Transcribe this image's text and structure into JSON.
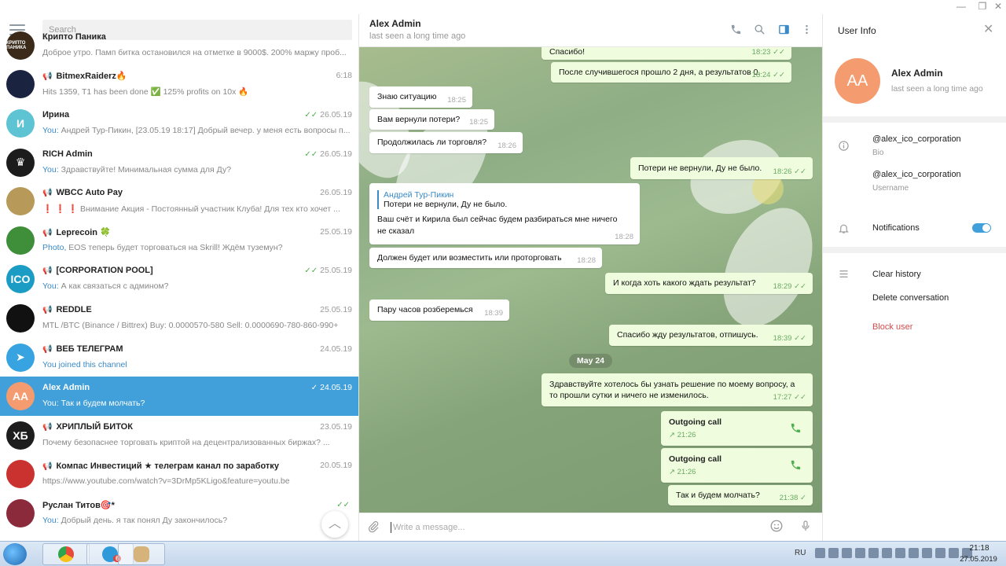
{
  "window": {
    "minimize": "—",
    "maximize": "❐",
    "close": "✕"
  },
  "search": {
    "placeholder": "Search"
  },
  "chats": [
    {
      "title": "Крипто Паника",
      "date": "",
      "preview": "Доброе утро. Памп битка остановился на отметке в 9000$. 200% маржу проб...",
      "you": "",
      "check": "",
      "avatar_text": "КРИПТО ПАНИКА",
      "avatar_color": "#3b2a1a",
      "channel": false
    },
    {
      "title": "BitmexRaiderz🔥",
      "date": "6:18",
      "preview": "Hits 1359, T1 has been done ✅  125% profits on 10x 🔥",
      "you": "",
      "check": "",
      "avatar_text": "",
      "avatar_color": "#1a2340",
      "channel": true
    },
    {
      "title": "Ирина",
      "date": "26.05.19",
      "preview": "Андрей Тур-Пикин, [23.05.19 18:17] Добрый вечер. у меня есть вопросы п...",
      "you": "You: ",
      "check": "✓✓",
      "avatar_text": "И",
      "avatar_color": "#5ec3d3",
      "channel": false
    },
    {
      "title": "RICH Admin",
      "date": "26.05.19",
      "preview": "Здравствуйте! Минимальная сумма для Ду?",
      "you": "You: ",
      "check": "✓✓",
      "avatar_text": "♛",
      "avatar_color": "#1c1c1c",
      "channel": false
    },
    {
      "title": "WBCC Auto Pay",
      "date": "26.05.19",
      "preview": "❗ ❗ ❗  Внимание Акция - Постоянный участник Клуба!   Для тех кто хочет ...",
      "you": "",
      "check": "",
      "avatar_text": "",
      "avatar_color": "#b79a5a",
      "channel": true
    },
    {
      "title": "Leprecoin 🍀",
      "date": "25.05.19",
      "preview": "EOS теперь будет торговаться на Skrill! Ждём туземун?",
      "you": "Photo, ",
      "check": "",
      "avatar_text": "",
      "avatar_color": "#3f8f3a",
      "channel": true
    },
    {
      "title": "[CORPORATION POOL]",
      "date": "25.05.19",
      "preview": "А как связаться с админом?",
      "you": "You: ",
      "check": "✓✓",
      "avatar_text": "ICO",
      "avatar_color": "#1b9cc4",
      "channel": true
    },
    {
      "title": "REDDLE",
      "date": "25.05.19",
      "preview": "MTL /BTC (Binance / Bittrex)  Buy: 0.0000570-580  Sell: 0.0000690-780-860-990+",
      "you": "",
      "check": "",
      "avatar_text": "",
      "avatar_color": "#111111",
      "channel": true
    },
    {
      "title": "ВЕБ ТЕЛЕГРАМ",
      "date": "24.05.19",
      "preview": "You joined this channel",
      "you": "",
      "check": "",
      "avatar_text": "➤",
      "avatar_color": "#37a3e0",
      "channel": true
    },
    {
      "title": "Alex Admin",
      "date": "24.05.19",
      "preview": "Так и будем молчать?",
      "you": "You: ",
      "check": "✓",
      "avatar_text": "AA",
      "avatar_color": "#f49c6f",
      "channel": false,
      "active": true
    },
    {
      "title": "ХРИПЛЫЙ БИТОК",
      "date": "23.05.19",
      "preview": "Почему безопаснее торговать криптой на децентрализованных биржах? ...",
      "you": "",
      "check": "",
      "avatar_text": "ХБ",
      "avatar_color": "#1d1d1d",
      "channel": true
    },
    {
      "title": "Компас Инвестиций ★ телеграм канал по заработку",
      "date": "20.05.19",
      "preview": "https://www.youtube.com/watch?v=3DrMp5KLigo&feature=youtu.be",
      "you": "",
      "check": "",
      "avatar_text": "",
      "avatar_color": "#c9322e",
      "channel": true
    },
    {
      "title": "Руслан Титов🎯*",
      "date": "",
      "preview": "Добрый день. я так понял Ду закончилось?",
      "you": "You: ",
      "check": "✓✓",
      "avatar_text": "",
      "avatar_color": "#8a2a3a",
      "channel": false
    }
  ],
  "header": {
    "name": "Alex Admin",
    "status": "last seen a long time ago"
  },
  "messages": {
    "m1": {
      "text": "Спасибо!",
      "time": "18:23"
    },
    "m2": {
      "text": "После случившегося прошло 2 дня, а результатов 0.",
      "time": "18:24"
    },
    "m3": {
      "text": "Знаю ситуацию",
      "time": "18:25"
    },
    "m4": {
      "text": "Вам вернули потери?",
      "time": "18:25"
    },
    "m5": {
      "text": "Продолжилась ли торговля?",
      "time": "18:26"
    },
    "m6": {
      "text": "Потери не вернули, Ду не было.",
      "time": "18:26"
    },
    "m7": {
      "reply_author": "Андрей Тур-Пикин",
      "reply_text": "Потери не вернули, Ду не было.",
      "text": "Ваш счёт и Кирила был сейчас будем разбираться мне ничего не сказал",
      "time": "18:28"
    },
    "m8": {
      "text": "Должен будет или возместить или проторговать",
      "time": "18:28"
    },
    "m9": {
      "text": "И когда хоть какого ждать результат?",
      "time": "18:29"
    },
    "m10": {
      "text": "Пару часов розберемься",
      "time": "18:39"
    },
    "m11": {
      "text": "Спасибо жду результатов, отпишусь.",
      "time": "18:39"
    },
    "date_sep": "May 24",
    "m12": {
      "text": "Здравствуйте хотелось бы узнать решение по моему вопросу, а то прошли сутки и ничего не изменилось.",
      "time": "17:27"
    },
    "call1": {
      "title": "Outgoing call",
      "time": "21:26"
    },
    "call2": {
      "title": "Outgoing call",
      "time": "21:26"
    },
    "m13": {
      "text": "Так и будем молчать?",
      "time": "21:38"
    }
  },
  "composer": {
    "placeholder": "Write a message..."
  },
  "info": {
    "title": "User Info",
    "avatar_text": "AA",
    "name": "Alex Admin",
    "status": "last seen a long time ago",
    "bio_value": "@alex_ico_corporation",
    "bio_label": "Bio",
    "username_value": "@alex_ico_corporation",
    "username_label": "Username",
    "notifications": "Notifications",
    "clear_history": "Clear history",
    "delete_conversation": "Delete conversation",
    "block_user": "Block user"
  },
  "taskbar": {
    "lang": "RU",
    "time": "21:18",
    "date": "27.05.2019",
    "telegram_badge": "6"
  },
  "colors": {
    "accent": "#419fd9",
    "out_bubble": "#effdde",
    "danger": "#d14d4d"
  }
}
